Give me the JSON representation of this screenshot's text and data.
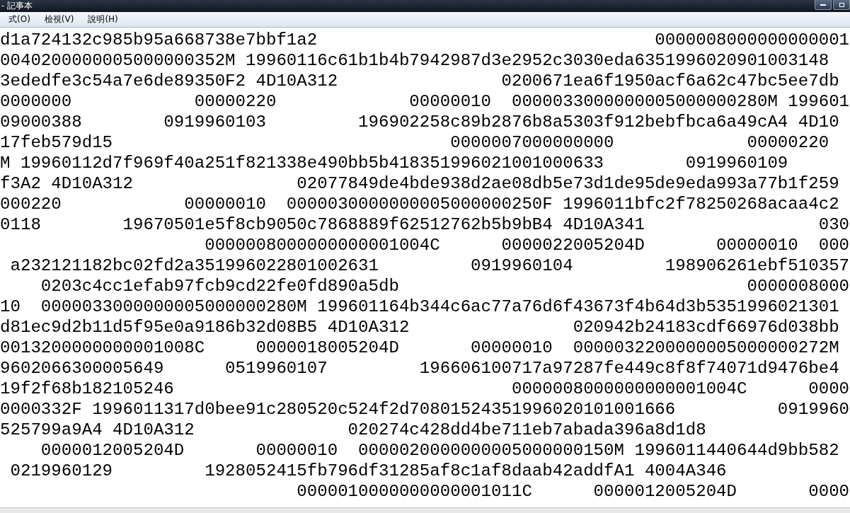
{
  "window": {
    "title": "- 記事本"
  },
  "menu": [
    "式(O)",
    "檢視(V)",
    "說明(H)"
  ],
  "lines": [
    "d1a724132c985b95a668738e7bbf1a2                                 0000008000000000001",
    "0040200000005000000352M 19960116c61b1b4b7942987d3e2952c3030eda6351996020901003148",
    "3ededfe3c54a7e6de89350F2 4D10A312                0200671ea6f1950acf6a62c47bc5ee7db",
    "0000000            00000220             00000010  0000033000000005000000280M 199601",
    "09000388        0919960103         196902258c89b2876b8a5303f912bebfbca6a49cA4 4D10",
    "17feb579d15                                 0000007000000000             00000220",
    "M 19960112d7f969f40a251f821338e490bb5b418351996021001000633        0919960109",
    "f3A2 4D10A312                02077849de4bde938d2ae08db5e73d1de95de9eda993a77b1f259",
    "000220            00000010  0000030000000005000000250F 1996011bfc2f78250268acaa4c2",
    "0118        19670501e5f8cb9050c7868889f62512762b5b9bB4 4D10A341                 030",
    "                    0000008000000000001004C      0000022005204D       00000010  000",
    " a232121182bc02fd2a351996022801002631         0919960104         198906261ebf510357",
    "    0203c4cc1efab97fcb9cd22fe0fd890a5db                                  0000008000",
    "10  0000033000000005000000280M 199601164b344c6ac77a76d6f43673f4b64d3b5351996021301",
    "d81ec9d2b11d5f95e0a9186b32d08B5 4D10A312                020942b24183cdf66976d038bb",
    "0013200000000001008C     0000018005204D       00000010  0000032200000005000000272M",
    "9602066300005649      0519960107         196606100717a97287fe449c8f8f74071d9476be4",
    "19f2f68b182105246                                 0000008000000000001004C      0000",
    "0000332F 1996011317d0bee91c280520c524f2d70801524351996020101001666          0919960",
    "525799a9A4 4D10A312               020274c428dd4be711eb7abada396a8d1d8",
    "    0000012005204D       00000010  0000020000000005000000150M 1996011440644d9bb582",
    " 0219960129         1928052415fb796df31285af8c1af8daab42addfA1 4004A346",
    "                             0000010000000000001011C      0000012005204D       0000"
  ]
}
